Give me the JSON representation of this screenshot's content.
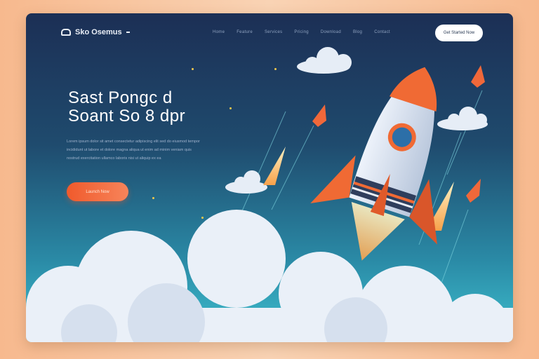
{
  "brand": {
    "name": "Sko Osemus"
  },
  "nav": {
    "links": [
      "Home",
      "Feature",
      "Services",
      "Pricing",
      "Download",
      "Blog",
      "Contact"
    ],
    "cta_label": "Get Started Now"
  },
  "hero": {
    "title_line1": "Sast Pongc d",
    "title_line2": "Soant So 8 dpr",
    "body_lines": [
      "Lorem ipsum dolor sit amet consectetur adipiscing elit sed do eiusmod tempor",
      "incididunt ut labore et dolore magna aliqua ut enim ad minim veniam quis",
      "nostrud exercitation ullamco laboris nisi ut aliquip ex ea"
    ],
    "cta_label": "Launch Now"
  },
  "colors": {
    "accent": "#f05a2c",
    "bg_top": "#1c2f55",
    "bg_bottom": "#3fc0cf",
    "cloud": "#e9f0f8"
  },
  "icons": [
    "logo-mark-icon",
    "rocket-icon"
  ]
}
